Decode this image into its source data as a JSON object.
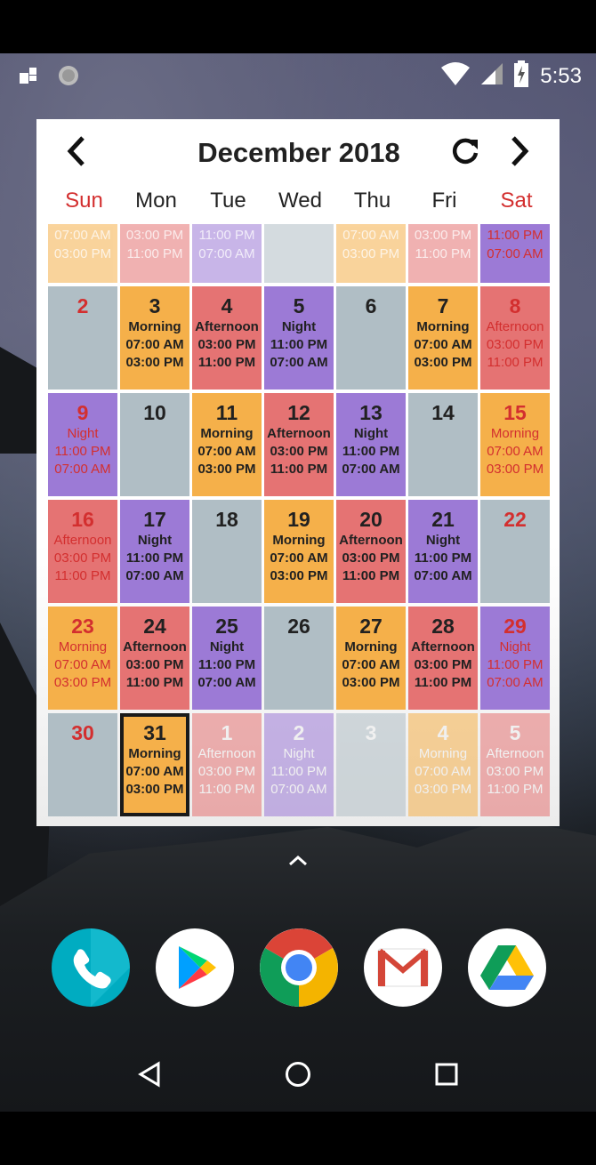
{
  "status_bar": {
    "time": "5:53",
    "icons": [
      "notification-icon",
      "sync-icon",
      "wifi-icon",
      "cellular-icon",
      "battery-charging-icon"
    ]
  },
  "widget": {
    "title": "December 2018",
    "buttons": {
      "prev": "chevron-left-icon",
      "refresh": "refresh-icon",
      "next": "chevron-right-icon"
    },
    "weekdays": [
      "Sun",
      "Mon",
      "Tue",
      "Wed",
      "Thu",
      "Fri",
      "Sat"
    ],
    "colors": {
      "morning": "#f5b04a",
      "afternoon": "#e57373",
      "night": "#9c7ad6",
      "off": "#b0bec5",
      "weekend_text": "#d32f2f"
    },
    "weeks": [
      [
        {
          "type": "morning",
          "lines": [
            "07:00 AM",
            "03:00 PM"
          ],
          "faded": true,
          "partial": true
        },
        {
          "type": "afternoon",
          "lines": [
            "03:00 PM",
            "11:00 PM"
          ],
          "faded": true,
          "partial": true
        },
        {
          "type": "night",
          "lines": [
            "11:00 PM",
            "07:00 AM"
          ],
          "faded": true,
          "partial": true
        },
        {
          "type": "off",
          "lines": [],
          "faded": true,
          "partial": true
        },
        {
          "type": "morning",
          "lines": [
            "07:00 AM",
            "03:00 PM"
          ],
          "faded": true,
          "partial": true
        },
        {
          "type": "afternoon",
          "lines": [
            "03:00 PM",
            "11:00 PM"
          ],
          "faded": true,
          "partial": true
        },
        {
          "type": "night",
          "lines": [
            "11:00 PM",
            "07:00 AM"
          ],
          "faded": false,
          "partial": true
        }
      ],
      [
        {
          "day": "2",
          "type": "off",
          "lines": []
        },
        {
          "day": "3",
          "type": "morning",
          "lines": [
            "Morning",
            "07:00 AM",
            "03:00 PM"
          ]
        },
        {
          "day": "4",
          "type": "afternoon",
          "lines": [
            "Afternoon",
            "03:00 PM",
            "11:00 PM"
          ]
        },
        {
          "day": "5",
          "type": "night",
          "lines": [
            "Night",
            "11:00 PM",
            "07:00 AM"
          ]
        },
        {
          "day": "6",
          "type": "off",
          "lines": []
        },
        {
          "day": "7",
          "type": "morning",
          "lines": [
            "Morning",
            "07:00 AM",
            "03:00 PM"
          ]
        },
        {
          "day": "8",
          "type": "afternoon",
          "lines": [
            "Afternoon",
            "03:00 PM",
            "11:00 PM"
          ]
        }
      ],
      [
        {
          "day": "9",
          "type": "night",
          "lines": [
            "Night",
            "11:00 PM",
            "07:00 AM"
          ]
        },
        {
          "day": "10",
          "type": "off",
          "lines": []
        },
        {
          "day": "11",
          "type": "morning",
          "lines": [
            "Morning",
            "07:00 AM",
            "03:00 PM"
          ]
        },
        {
          "day": "12",
          "type": "afternoon",
          "lines": [
            "Afternoon",
            "03:00 PM",
            "11:00 PM"
          ]
        },
        {
          "day": "13",
          "type": "night",
          "lines": [
            "Night",
            "11:00 PM",
            "07:00 AM"
          ]
        },
        {
          "day": "14",
          "type": "off",
          "lines": []
        },
        {
          "day": "15",
          "type": "morning",
          "lines": [
            "Morning",
            "07:00 AM",
            "03:00 PM"
          ]
        }
      ],
      [
        {
          "day": "16",
          "type": "afternoon",
          "lines": [
            "Afternoon",
            "03:00 PM",
            "11:00 PM"
          ]
        },
        {
          "day": "17",
          "type": "night",
          "lines": [
            "Night",
            "11:00 PM",
            "07:00 AM"
          ]
        },
        {
          "day": "18",
          "type": "off",
          "lines": []
        },
        {
          "day": "19",
          "type": "morning",
          "lines": [
            "Morning",
            "07:00 AM",
            "03:00 PM"
          ]
        },
        {
          "day": "20",
          "type": "afternoon",
          "lines": [
            "Afternoon",
            "03:00 PM",
            "11:00 PM"
          ]
        },
        {
          "day": "21",
          "type": "night",
          "lines": [
            "Night",
            "11:00 PM",
            "07:00 AM"
          ]
        },
        {
          "day": "22",
          "type": "off",
          "lines": []
        }
      ],
      [
        {
          "day": "23",
          "type": "morning",
          "lines": [
            "Morning",
            "07:00 AM",
            "03:00 PM"
          ]
        },
        {
          "day": "24",
          "type": "afternoon",
          "lines": [
            "Afternoon",
            "03:00 PM",
            "11:00 PM"
          ]
        },
        {
          "day": "25",
          "type": "night",
          "lines": [
            "Night",
            "11:00 PM",
            "07:00 AM"
          ]
        },
        {
          "day": "26",
          "type": "off",
          "lines": []
        },
        {
          "day": "27",
          "type": "morning",
          "lines": [
            "Morning",
            "07:00 AM",
            "03:00 PM"
          ]
        },
        {
          "day": "28",
          "type": "afternoon",
          "lines": [
            "Afternoon",
            "03:00 PM",
            "11:00 PM"
          ]
        },
        {
          "day": "29",
          "type": "night",
          "lines": [
            "Night",
            "11:00 PM",
            "07:00 AM"
          ]
        }
      ],
      [
        {
          "day": "30",
          "type": "off",
          "lines": []
        },
        {
          "day": "31",
          "type": "morning",
          "lines": [
            "Morning",
            "07:00 AM",
            "03:00 PM"
          ],
          "today": true
        },
        {
          "day": "1",
          "type": "afternoon",
          "lines": [
            "Afternoon",
            "03:00 PM",
            "11:00 PM"
          ],
          "faded": true
        },
        {
          "day": "2",
          "type": "night",
          "lines": [
            "Night",
            "11:00 PM",
            "07:00 AM"
          ],
          "faded": true
        },
        {
          "day": "3",
          "type": "off",
          "lines": [],
          "faded": true
        },
        {
          "day": "4",
          "type": "morning",
          "lines": [
            "Morning",
            "07:00 AM",
            "03:00 PM"
          ],
          "faded": true
        },
        {
          "day": "5",
          "type": "afternoon",
          "lines": [
            "Afternoon",
            "03:00 PM",
            "11:00 PM"
          ],
          "faded": true
        }
      ]
    ]
  },
  "dock": {
    "apps": [
      {
        "name": "phone-app-icon"
      },
      {
        "name": "play-store-app-icon"
      },
      {
        "name": "chrome-app-icon"
      },
      {
        "name": "gmail-app-icon"
      },
      {
        "name": "drive-app-icon"
      }
    ]
  },
  "nav_bar": {
    "buttons": [
      "back-icon",
      "home-icon",
      "recents-icon"
    ]
  }
}
